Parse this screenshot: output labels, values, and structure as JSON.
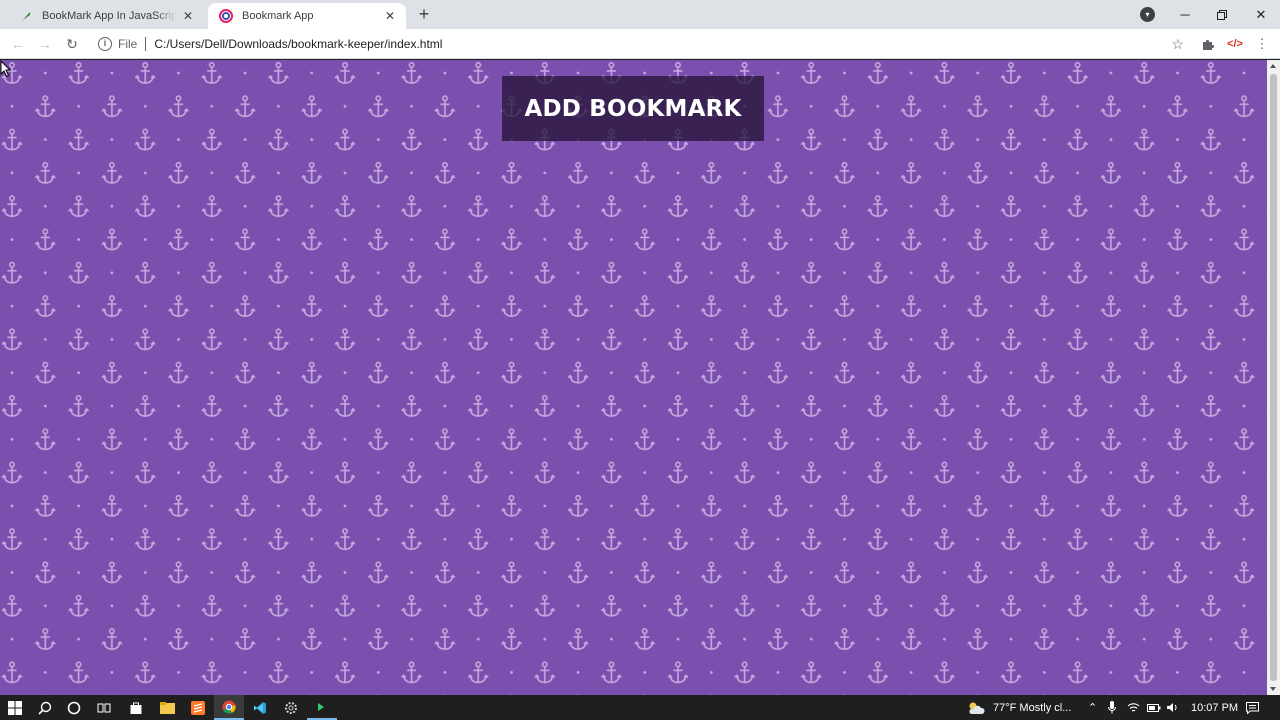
{
  "browser": {
    "tabs": [
      {
        "title": "BookMark App In JavaScript Wit",
        "favicon": "feather-icon",
        "active": false
      },
      {
        "title": "Bookmark App",
        "favicon": "app-logo-icon",
        "active": true
      }
    ],
    "address": {
      "scheme_label": "File",
      "url": "C:/Users/Dell/Downloads/bookmark-keeper/index.html"
    }
  },
  "page": {
    "add_bookmark_label": "ADD BOOKMARK",
    "background_color": "#7b4fae",
    "pattern": "anchor-icon"
  },
  "taskbar": {
    "weather": "77°F  Mostly cl...",
    "time": "10:07 PM"
  }
}
